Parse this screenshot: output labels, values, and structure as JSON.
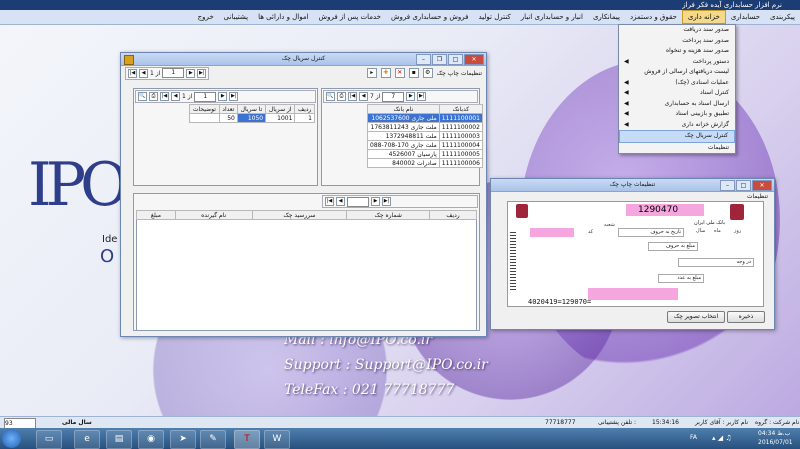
{
  "app": {
    "title": "نرم افزار حسابداری آیده فکر فراز"
  },
  "menubar": {
    "items": [
      "پیکربندی",
      "حسابداری",
      "خزانه داری",
      "حقوق و دستمزد",
      "پیمانکاری",
      "انبار و حسابداری انبار",
      "کنترل تولید",
      "فروش و حسابداری فروش",
      "خدمات پس از فروش",
      "اموال و دارائی ها",
      "پشتیبانی",
      "خروج"
    ],
    "active_index": 2
  },
  "dropdown": {
    "items": [
      {
        "label": "صدور سند دریافت",
        "arrow": false
      },
      {
        "label": "صدور سند پرداخت",
        "arrow": false
      },
      {
        "label": "صدور سند هزینه و تنخواه",
        "arrow": false
      },
      {
        "label": "دستور پرداخت",
        "arrow": true
      },
      {
        "label": "لیست دریافتهای ارسالی از فروش",
        "arrow": false
      },
      {
        "label": "عملیات اسنادی (چک)",
        "arrow": true
      },
      {
        "label": "کنترل اسناد",
        "arrow": true
      },
      {
        "label": "ارسال اسناد به حسابداری",
        "arrow": true
      },
      {
        "label": "تطبیق و بازبینی اسناد",
        "arrow": true
      },
      {
        "label": "گزارش خزانه داری",
        "arrow": true
      },
      {
        "label": "کنترل سریال چک",
        "arrow": false
      },
      {
        "label": "تنظیمات",
        "arrow": false
      }
    ],
    "highlight_index": 10
  },
  "serial_window": {
    "title": "کنترل سریال چک",
    "toolbar_label": "تنظیمات چاپ چک",
    "nav_left": {
      "page": "1",
      "total": "از 1"
    },
    "nav_right": {
      "page": "7",
      "total": "از 7"
    },
    "nav_top": {
      "page": "1",
      "total": "از 1"
    },
    "right_grid": {
      "headers": [
        "کدبانک",
        "نام بانک"
      ],
      "rows": [
        [
          "1111100001",
          "ملی جاری 1062537600"
        ],
        [
          "1111100002",
          "ملت جاری 1763811243"
        ],
        [
          "1111100003",
          "ملت 1372948811"
        ],
        [
          "1111100004",
          "ملت جاری 170-708-088"
        ],
        [
          "1111100005",
          "پارسیان 4526007"
        ],
        [
          "1111100006",
          "صادرات 840002"
        ]
      ],
      "selected_index": 0
    },
    "left_grid": {
      "headers": [
        "ردیف",
        "از سریال",
        "تا سریال",
        "تعداد",
        "توضیحات"
      ],
      "rows": [
        [
          "1",
          "1001",
          "1050",
          "50",
          ""
        ]
      ]
    },
    "bottom_grid": {
      "headers": [
        "ردیف",
        "شماره چک",
        "سررسید چک",
        "نام گیرنده",
        "مبلغ"
      ]
    }
  },
  "print_window": {
    "title": "تنظیمات چاپ چک",
    "subtitle": "تنظیمات",
    "cheque": {
      "bank": "بانک ملی ایران",
      "date": "1290470",
      "day": "روز",
      "month": "ماه",
      "year": "سال",
      "date_words": "تاریخ به حروف",
      "amount_words": "مبلغ به حروف",
      "pay_to": "در وجه",
      "amount_digits": "مبلغ به عدد",
      "branch": "شعبه",
      "code": "کد",
      "micr": "4020419=129070="
    },
    "save_button": "ذخیره",
    "image_button": "انتخاب تصویر چک"
  },
  "contact": {
    "mail": "Mail : info@IPO.co.ir",
    "support": "Support : Support@IPO.co.ir",
    "telefax": "TeleFax : 021 77718777"
  },
  "logo": {
    "letters": "IPO",
    "side_text_1": "Ide",
    "side_text_2": "O"
  },
  "statusbar": {
    "fiscal_year_label": "سال مالی",
    "fiscal_year": "93",
    "company": "نام شرکت : گروه فراز",
    "user": "نام کاربر : آقای کاربر",
    "time": "15:34:16",
    "support_phone_label": "تلفن پشتیبانی :",
    "support_phone": "77718777"
  },
  "taskbar": {
    "lang": "FA",
    "clock_time": "04:34 ب.ظ",
    "clock_date": "2016/07/01"
  }
}
